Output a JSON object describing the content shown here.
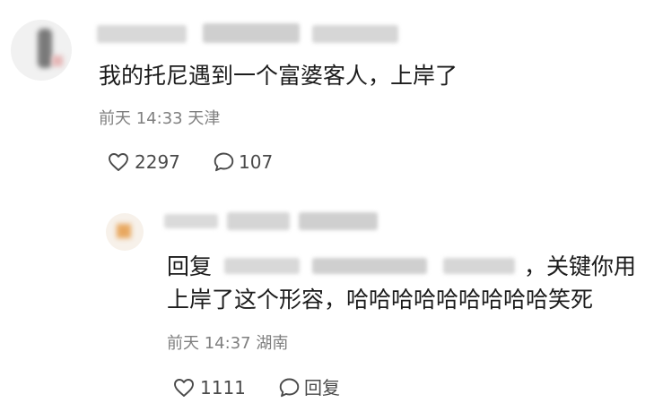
{
  "comment": {
    "text": "我的托尼遇到一个富婆客人，上岸了",
    "time": "前天 14:33",
    "location": "天津",
    "likes": "2297",
    "replies": "107"
  },
  "reply": {
    "prefix": "回复",
    "text_tail": "，关键你用",
    "text_line2": "上岸了这个形容，哈哈哈哈哈哈哈哈哈笑死",
    "time": "前天 14:37",
    "location": "湖南",
    "likes": "1111",
    "reply_label": "回复"
  },
  "icons": {
    "like": "heart-outline-icon",
    "comment": "speech-bubble-icon"
  }
}
